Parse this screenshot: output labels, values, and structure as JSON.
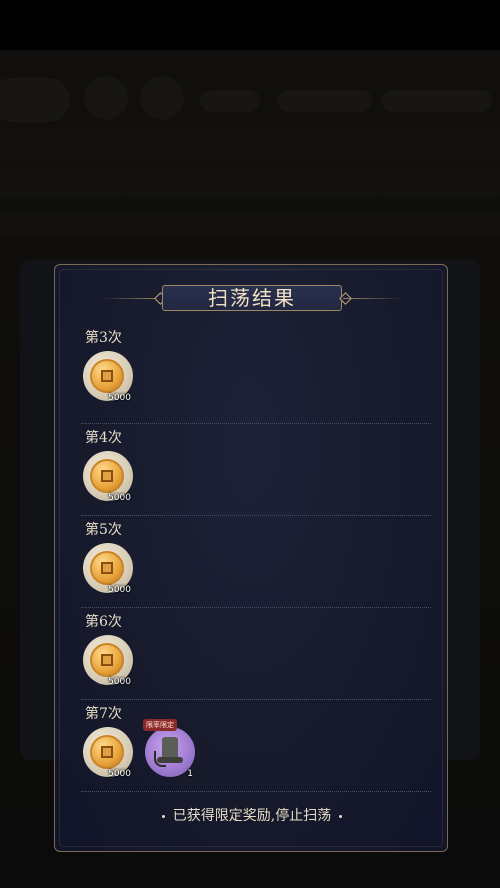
{
  "dialog": {
    "title": "扫荡结果",
    "footer": "已获得限定奖励,停止扫荡"
  },
  "rounds": [
    {
      "label": "第3次",
      "rewards": [
        {
          "icon": "copper-coin-icon",
          "qty": "5000"
        }
      ]
    },
    {
      "label": "第4次",
      "rewards": [
        {
          "icon": "copper-coin-icon",
          "qty": "5000"
        }
      ]
    },
    {
      "label": "第5次",
      "rewards": [
        {
          "icon": "copper-coin-icon",
          "qty": "5000"
        }
      ]
    },
    {
      "label": "第6次",
      "rewards": [
        {
          "icon": "copper-coin-icon",
          "qty": "5000"
        }
      ]
    },
    {
      "label": "第7次",
      "rewards": [
        {
          "icon": "copper-coin-icon",
          "qty": "5000"
        },
        {
          "icon": "bell-item-icon",
          "qty": "1",
          "tag": "限率限定"
        }
      ]
    }
  ],
  "colors": {
    "panel_bg": "#161a2b",
    "panel_border": "#7a6a54",
    "title_text": "#f0e2c2",
    "body_text": "#e6dcc8"
  }
}
